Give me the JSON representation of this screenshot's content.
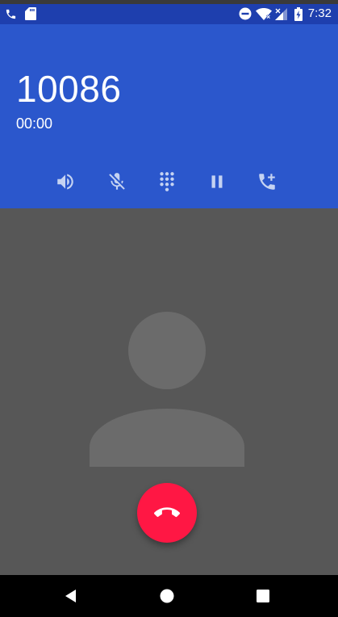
{
  "status_bar": {
    "time": "7:32",
    "left_icons": [
      "phone-icon",
      "sd-card-icon"
    ],
    "right_icons": [
      "do-not-disturb-icon",
      "wifi-icon",
      "cellular-no-signal-icon",
      "battery-charging-icon"
    ]
  },
  "call": {
    "number": "10086",
    "duration": "00:00"
  },
  "controls": [
    {
      "name": "speaker",
      "icon": "speaker-icon"
    },
    {
      "name": "mute",
      "icon": "mic-off-icon"
    },
    {
      "name": "dialpad",
      "icon": "dialpad-icon"
    },
    {
      "name": "hold",
      "icon": "pause-icon"
    },
    {
      "name": "add-call",
      "icon": "add-call-icon"
    }
  ],
  "end_call": {
    "icon": "call-end-icon"
  },
  "nav": {
    "icons": [
      "back-icon",
      "home-icon",
      "recents-icon"
    ]
  },
  "colors": {
    "status_bar": "#1e3fae",
    "header": "#2b57cc",
    "background": "#575757",
    "avatar": "#6b6b6b",
    "end_call": "#ff1744",
    "controls": "#c5d3f2"
  }
}
